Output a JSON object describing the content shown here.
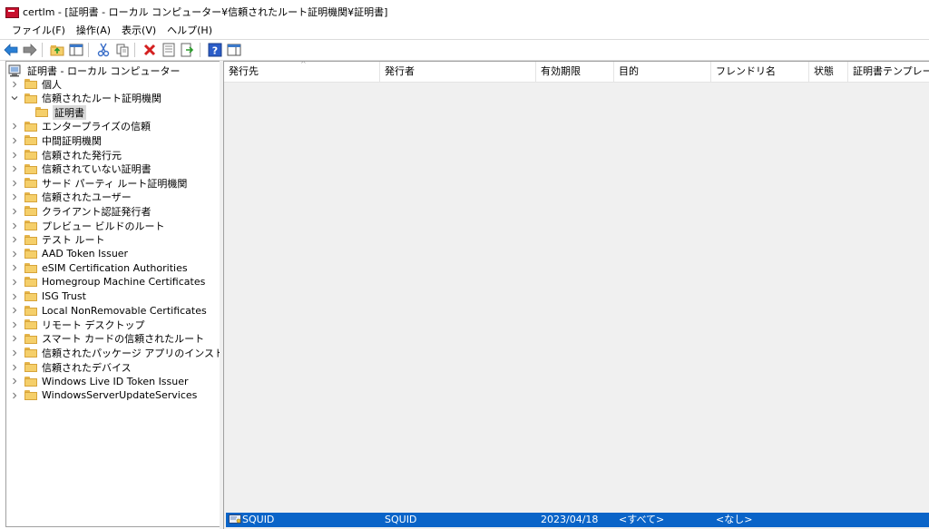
{
  "window": {
    "title": "certlm - [証明書 - ローカル コンピューター¥信頼されたルート証明機関¥証明書]"
  },
  "menu": [
    "ファイル(F)",
    "操作(A)",
    "表示(V)",
    "ヘルプ(H)"
  ],
  "toolbar": {
    "icons": [
      "back-arrow-icon",
      "forward-arrow-icon",
      "up-folder-icon",
      "show-hide-tree-icon",
      "cut-icon",
      "copy-icon",
      "delete-icon",
      "properties-icon",
      "export-icon",
      "help-icon",
      "action-pane-icon"
    ]
  },
  "tree": {
    "root": "証明書 - ローカル コンピューター",
    "items": [
      {
        "label": "個人",
        "expanded": false
      },
      {
        "label": "信頼されたルート証明機関",
        "expanded": true
      },
      {
        "label": "証明書",
        "child": true,
        "selected": true
      },
      {
        "label": "エンタープライズの信頼",
        "expanded": false
      },
      {
        "label": "中間証明機関",
        "expanded": false
      },
      {
        "label": "信頼された発行元",
        "expanded": false
      },
      {
        "label": "信頼されていない証明書",
        "expanded": false
      },
      {
        "label": "サード パーティ ルート証明機関",
        "expanded": false
      },
      {
        "label": "信頼されたユーザー",
        "expanded": false
      },
      {
        "label": "クライアント認証発行者",
        "expanded": false
      },
      {
        "label": "プレビュー ビルドのルート",
        "expanded": false
      },
      {
        "label": "テスト ルート",
        "expanded": false
      },
      {
        "label": "AAD Token Issuer",
        "expanded": false
      },
      {
        "label": "eSIM Certification Authorities",
        "expanded": false
      },
      {
        "label": "Homegroup Machine Certificates",
        "expanded": false
      },
      {
        "label": "ISG Trust",
        "expanded": false
      },
      {
        "label": "Local NonRemovable Certificates",
        "expanded": false
      },
      {
        "label": "リモート デスクトップ",
        "expanded": false
      },
      {
        "label": "スマート カードの信頼されたルート",
        "expanded": false
      },
      {
        "label": "信頼されたパッケージ アプリのインストール機関",
        "expanded": false
      },
      {
        "label": "信頼されたデバイス",
        "expanded": false
      },
      {
        "label": "Windows Live ID Token Issuer",
        "expanded": false
      },
      {
        "label": "WindowsServerUpdateServices",
        "expanded": false
      }
    ]
  },
  "list": {
    "columns": [
      "発行先",
      "発行者",
      "有効期限",
      "目的",
      "フレンドリ名",
      "状態",
      "証明書テンプレート"
    ],
    "rows": [
      {
        "issued_to": "SQUID",
        "issued_by": "SQUID",
        "expires": "2023/04/18",
        "purpose": "<すべて>",
        "friendly_name": "<なし>",
        "status": "",
        "template": ""
      }
    ]
  },
  "colors": {
    "selection": "#0a64c8",
    "folder": "#f5cf6a",
    "list_background": "#f0f0f0"
  }
}
